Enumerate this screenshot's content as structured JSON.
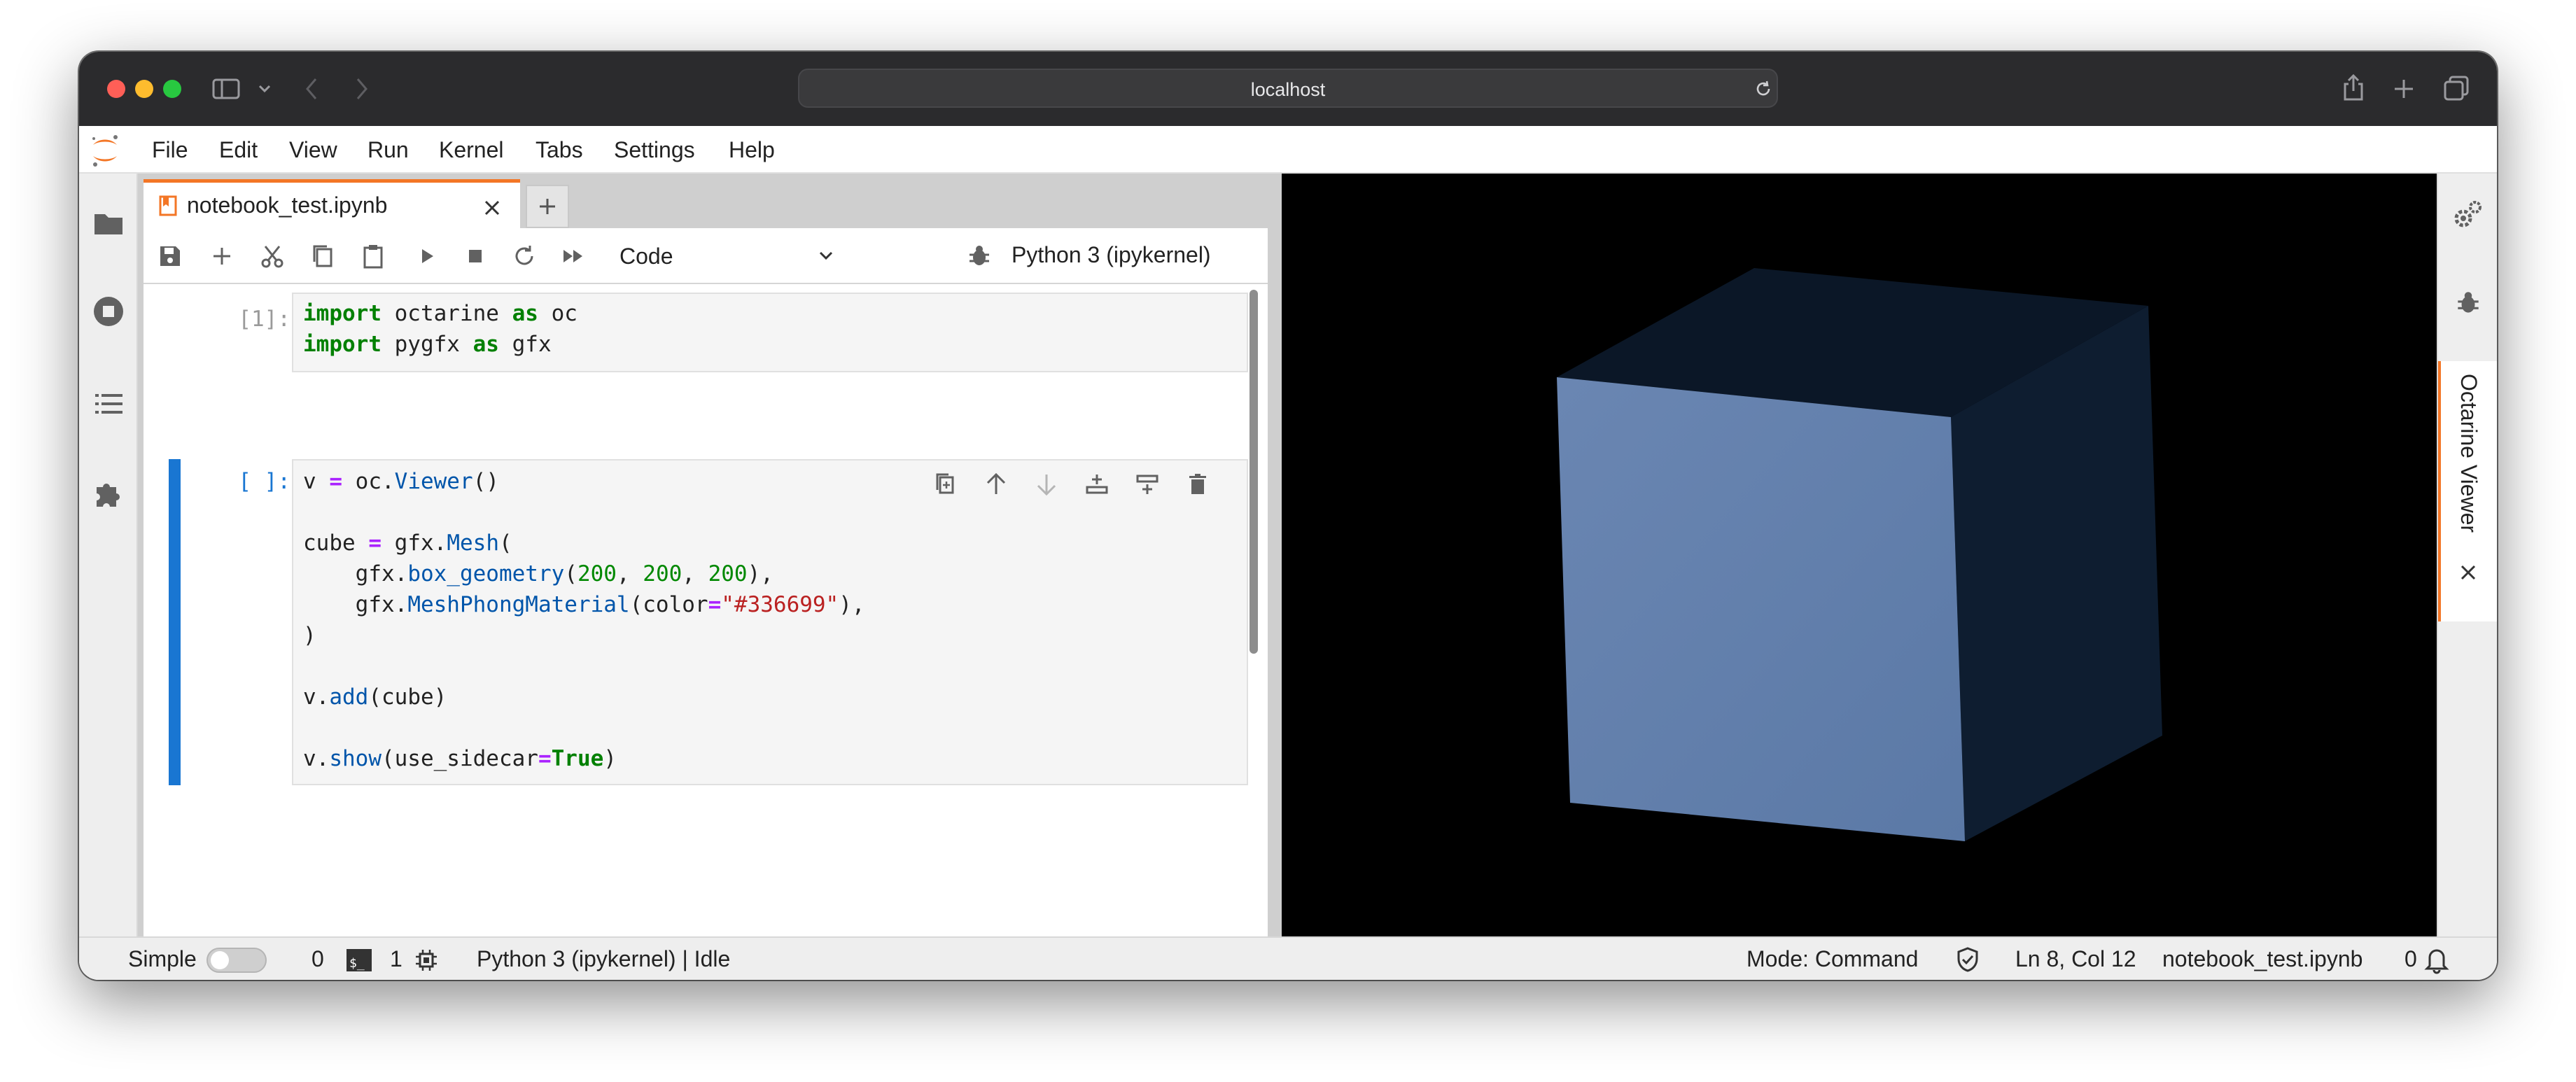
{
  "browser": {
    "address": "localhost",
    "traffic_lights": [
      "close",
      "minimize",
      "zoom"
    ],
    "icons": [
      "sidebar-icon",
      "chevron-down-icon",
      "back-icon",
      "forward-icon",
      "reload-icon",
      "share-icon",
      "new-tab-icon",
      "tab-overview-icon"
    ]
  },
  "menu": {
    "logo": "jupyter-logo-icon",
    "items": [
      "File",
      "Edit",
      "View",
      "Run",
      "Kernel",
      "Tabs",
      "Settings",
      "Help"
    ]
  },
  "left_sidebar": {
    "icons": [
      "folder-icon",
      "running-icon",
      "toc-icon",
      "extension-icon"
    ]
  },
  "tabs": {
    "active_label": "notebook_test.ipynb",
    "add_label": "+"
  },
  "toolbar": {
    "cell_type": "Code",
    "kernel": "Python 3 (ipykernel)"
  },
  "cells": [
    {
      "prompt": "[1]:",
      "lines": [
        "import octarine as oc",
        "import pygfx as gfx"
      ]
    },
    {
      "prompt": "[ ]:",
      "lines": [
        "v = oc.Viewer()",
        "",
        "cube = gfx.Mesh(",
        "    gfx.box_geometry(200, 200, 200),",
        "    gfx.MeshPhongMaterial(color=\"#336699\"),",
        ")",
        "",
        "v.add(cube)",
        "",
        "v.show(use_sidecar=True)"
      ]
    }
  ],
  "viewer": {
    "tab_label": "Octarine Viewer",
    "background": "#000000",
    "cube_color": "#336699"
  },
  "right_sidebar": {
    "icons": [
      "property-inspector-icon",
      "debugger-icon"
    ]
  },
  "status": {
    "mode_label": "Simple",
    "simple_on": false,
    "terminals": "0",
    "kernels": "1",
    "kernel_status": "Python 3 (ipykernel) | Idle",
    "mode": "Mode: Command",
    "position": "Ln 8, Col 12",
    "filename": "notebook_test.ipynb",
    "notifications": "0"
  },
  "colors": {
    "accent": "#f37626",
    "active_cell": "#1976d2"
  }
}
